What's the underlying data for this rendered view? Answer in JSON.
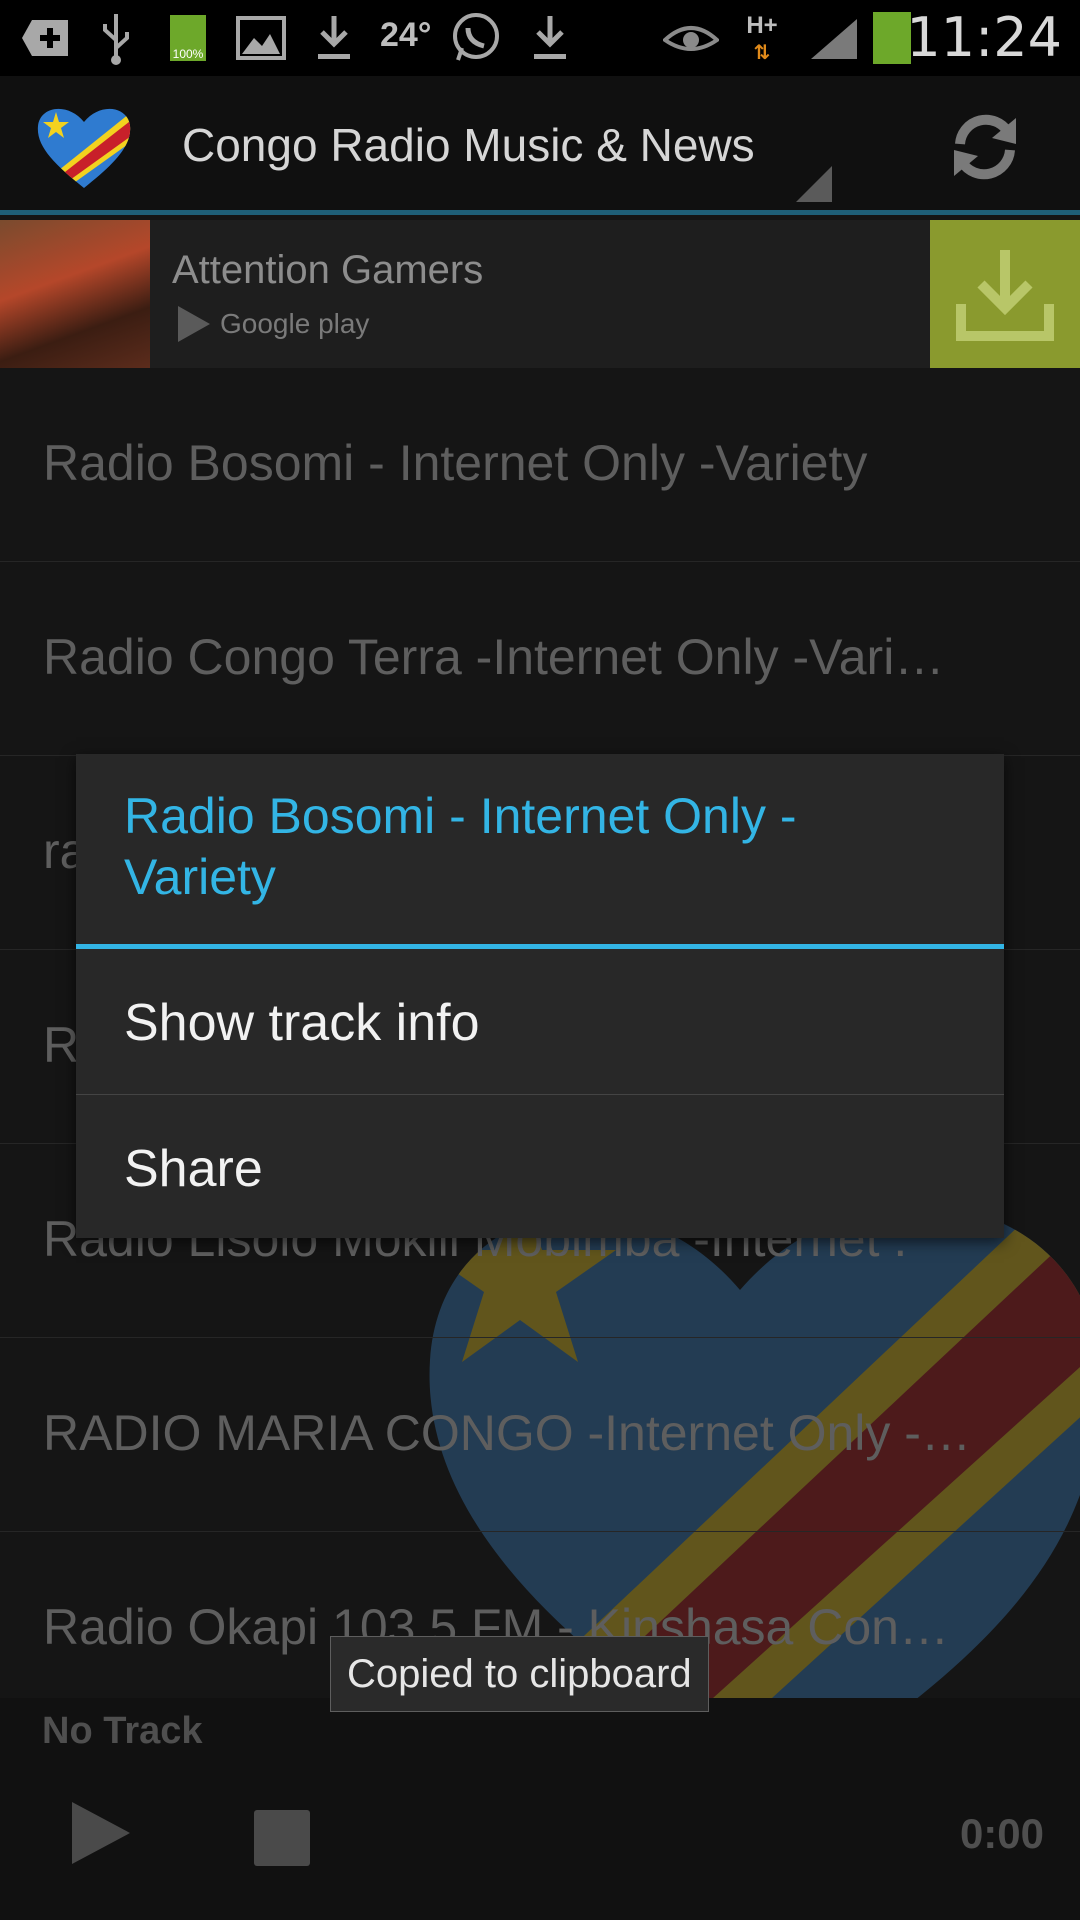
{
  "status_bar": {
    "time": "11:24",
    "temperature": "24°",
    "battery_small": "100%",
    "network": "H+",
    "icons": [
      "add-icon",
      "usb-icon",
      "battery-full-icon",
      "image-icon",
      "download-icon",
      "whatsapp-icon",
      "download-icon",
      "eye-icon",
      "network-h-plus-icon",
      "signal-icon",
      "battery-icon"
    ]
  },
  "app_bar": {
    "title": "Congo Radio Music & News",
    "logo": "congo-heart-logo",
    "refresh_icon": "refresh-icon"
  },
  "ad": {
    "title": "Attention Gamers",
    "store": "Google play",
    "accent": "#8a9a2e"
  },
  "stations": [
    "Radio Bosomi - Internet Only -Variety",
    "Radio Congo Terra -Internet Only -Vari…",
    "ra",
    "R",
    "Radio Lisolo Mokili Mobimba -Internet .",
    "RADIO MARIA CONGO -Internet Only -…",
    "Radio Okapi 103.5 FM - Kinshasa Con…"
  ],
  "player": {
    "track": "No Track",
    "time": "0:00"
  },
  "dialog": {
    "title": "Radio Bosomi - Internet Only - Variety",
    "items": [
      "Show track info",
      "Share"
    ],
    "accent": "#33b5e5"
  },
  "toast": {
    "text": "Copied to clipboard"
  }
}
